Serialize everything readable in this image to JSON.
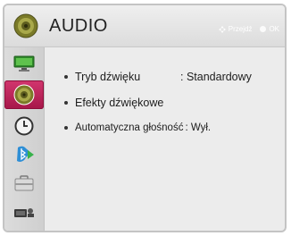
{
  "header": {
    "title": "AUDIO",
    "hint_move": "Przejdź",
    "hint_ok": "OK"
  },
  "sidebar": {
    "items": [
      {
        "name": "picture",
        "icon": "monitor-icon",
        "active": false
      },
      {
        "name": "audio",
        "icon": "speaker-icon",
        "active": true
      },
      {
        "name": "time",
        "icon": "clock-icon",
        "active": false
      },
      {
        "name": "bluetooth",
        "icon": "bluetooth-icon",
        "active": false
      },
      {
        "name": "option",
        "icon": "toolbox-icon",
        "active": false
      },
      {
        "name": "input",
        "icon": "input-icon",
        "active": false
      }
    ]
  },
  "menu": {
    "items": [
      {
        "label": "Tryb dźwięku",
        "value": ": Standardowy"
      },
      {
        "label": "Efekty dźwiękowe",
        "value": ""
      },
      {
        "label": "Automatyczna głośność",
        "value": ": Wył."
      }
    ]
  },
  "colors": {
    "accent": "#c02760",
    "background": "#ececec"
  }
}
